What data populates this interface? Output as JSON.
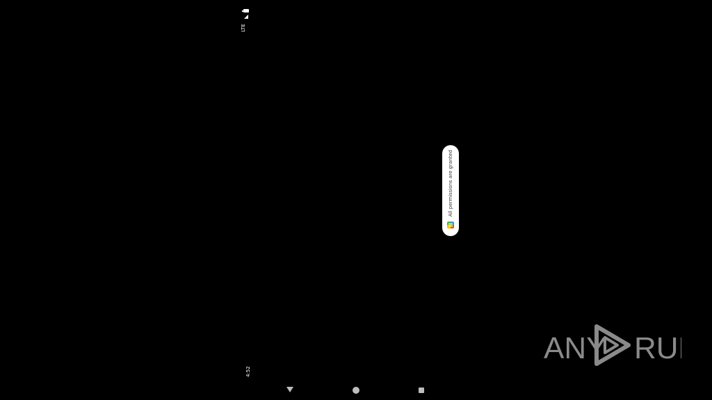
{
  "status_bar": {
    "network_label": "LTE",
    "clock": "4:52",
    "icons": [
      "signal-icon",
      "battery-icon"
    ]
  },
  "toast": {
    "message": "All permissions are granted",
    "icon": "app-icon"
  },
  "nav_bar": {
    "buttons": [
      "back-button",
      "home-button",
      "recents-button"
    ]
  },
  "watermark": {
    "text": "ANY RUN",
    "color": "#8a8a8a"
  },
  "colors": {
    "background": "#000000",
    "toast_background": "#ffffff",
    "nav_icons": "#bdbdbd"
  }
}
